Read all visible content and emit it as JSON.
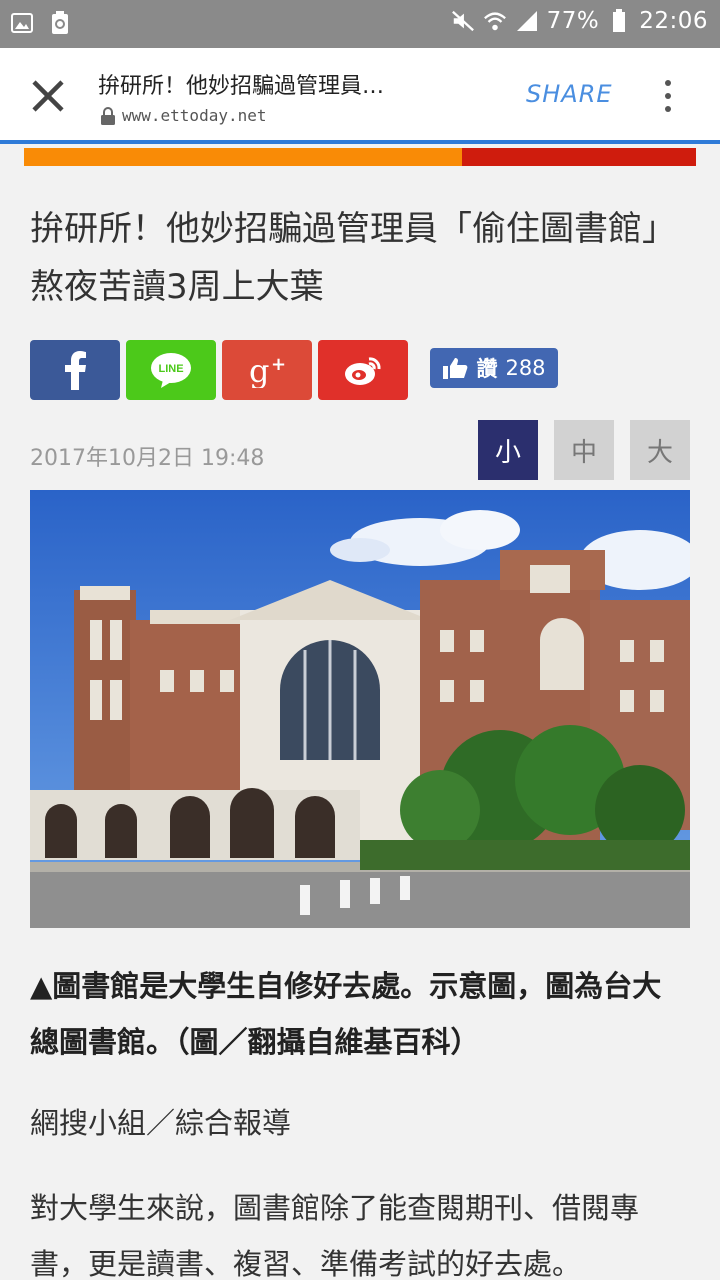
{
  "status_bar": {
    "battery": "77%",
    "time": "22:06",
    "icons": [
      "gallery-icon",
      "recycle-icon",
      "mute-icon",
      "wifi-icon",
      "signal-icon",
      "battery-icon"
    ]
  },
  "browser": {
    "page_title": "拚研所！他妙招騙過管理員…",
    "url": "www.ettoday.net",
    "share_label": "SHARE"
  },
  "colors": {
    "accent_orange": "#f98b06",
    "accent_red": "#cf1c0d",
    "fb": "#3b5998",
    "line": "#4cc91a",
    "gplus": "#dc4a38",
    "weibo": "#e0302a",
    "font_active": "#2b2f6e"
  },
  "article": {
    "headline": "拚研所！他妙招騙過管理員「偷住圖書館」　熬夜苦讀3周上大葉",
    "like_label": "讚",
    "like_count": "288",
    "line_label": "LINE",
    "date": "2017年10月2日 19:48",
    "font_sizes": [
      "小",
      "中",
      "大"
    ],
    "caption": "▲圖書館是大學生自修好去處。示意圖，圖為台大總圖書館。（圖／翻攝自維基百科）",
    "byline": "網搜小組／綜合報導",
    "body": "對大學生來說，圖書館除了能查閱期刊、借閱專書，更是讀書、複習、準備考試的好去處。"
  }
}
